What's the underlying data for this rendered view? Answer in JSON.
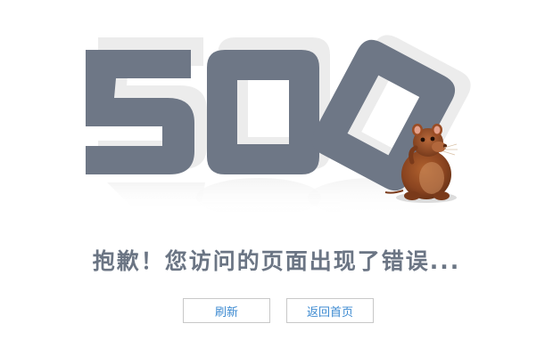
{
  "error_code": {
    "digit_1": "5",
    "digit_2": "0",
    "digit_3": "0"
  },
  "message": "抱歉！您访问的页面出现了错误...",
  "buttons": {
    "refresh_label": "刷新",
    "home_label": "返回首页"
  },
  "colors": {
    "digit_fill": "#6e7786",
    "digit_back": "#ececec",
    "message_text": "#6b7584",
    "button_text": "#3c8ad1",
    "button_border": "#c8c8c8"
  },
  "icons": {
    "mascot": "rat-mascot-icon"
  }
}
